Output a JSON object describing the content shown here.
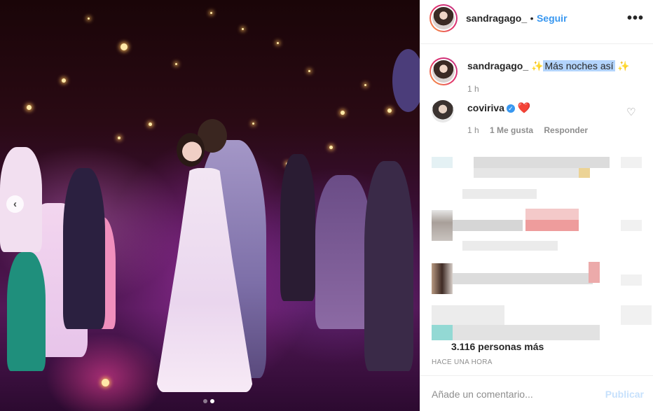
{
  "post": {
    "author": "sandragago_",
    "follow_label": "Seguir",
    "separator": "•",
    "more_icon": "more-options-icon",
    "caption": {
      "author": "sandragago_",
      "sparkle_left": "✨",
      "text": "Más noches así",
      "sparkle_right": "✨",
      "time": "1 h"
    },
    "image": {
      "nav_left_icon": "chevron-left-icon",
      "nav_left_label": "‹",
      "carousel_pages": 2,
      "carousel_active_index": 1
    }
  },
  "comments": [
    {
      "author": "coviriva",
      "verified": true,
      "verified_icon": "verified-badge-icon",
      "text": "❤️",
      "time": "1 h",
      "likes": "1 Me gusta",
      "reply_label": "Responder",
      "like_icon": "heart-outline-icon"
    }
  ],
  "likes_summary": "3.116 personas más",
  "time_ago": "HACE UNA HORA",
  "comment_input": {
    "placeholder": "Añade un comentario..."
  },
  "publish_label": "Publicar",
  "colors": {
    "accent": "#3897f0",
    "publish_disabled": "#c7e1fc",
    "text_primary": "#262626",
    "text_secondary": "#8e8e8e",
    "highlight": "#b3d4fc",
    "story_ring_start": "#f9a33a",
    "story_ring_end": "#c13584"
  }
}
